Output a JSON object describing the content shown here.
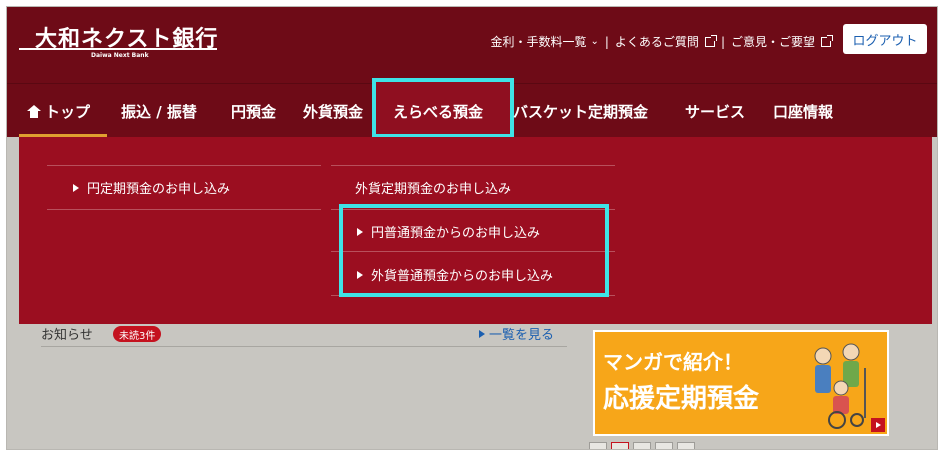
{
  "header": {
    "logo_text": "大和ネクスト銀行",
    "logo_sub": "Daiwa Next Bank",
    "util_links": [
      {
        "label": "金利・手数料一覧",
        "icon": "chevron-down-icon"
      },
      {
        "label": "よくあるご質問",
        "icon": "external-link-icon"
      },
      {
        "label": "ご意見・ご要望",
        "icon": "external-link-icon"
      }
    ],
    "logout_label": "ログアウト"
  },
  "nav": {
    "items": [
      {
        "label": "トップ",
        "active": true,
        "icon": "home-icon"
      },
      {
        "label": "振込 / 振替"
      },
      {
        "label": "円預金"
      },
      {
        "label": "外貨預金"
      },
      {
        "label": "えらべる預金",
        "highlighted": true
      },
      {
        "label": "バスケット定期預金"
      },
      {
        "label": "サービス"
      },
      {
        "label": "口座情報"
      }
    ]
  },
  "dropdown": {
    "left_items": [
      {
        "label": "円定期預金のお申し込み"
      }
    ],
    "right_heading": "外貨定期預金のお申し込み",
    "right_items": [
      {
        "label": "円普通預金からのお申し込み"
      },
      {
        "label": "外貨普通預金からのお申し込み"
      }
    ]
  },
  "content": {
    "notice_label": "お知らせ",
    "unread_badge": "未読3件",
    "more_link": "一覧を見る",
    "banner_line1": "マンガで紹介！",
    "banner_line2": "応援定期預金"
  },
  "colors": {
    "header_bg": "#6e0b17",
    "dropdown_bg": "#9b0e20",
    "highlight": "#3fe3e6",
    "active_underline": "#e0a030",
    "banner_bg": "#f7a619"
  }
}
